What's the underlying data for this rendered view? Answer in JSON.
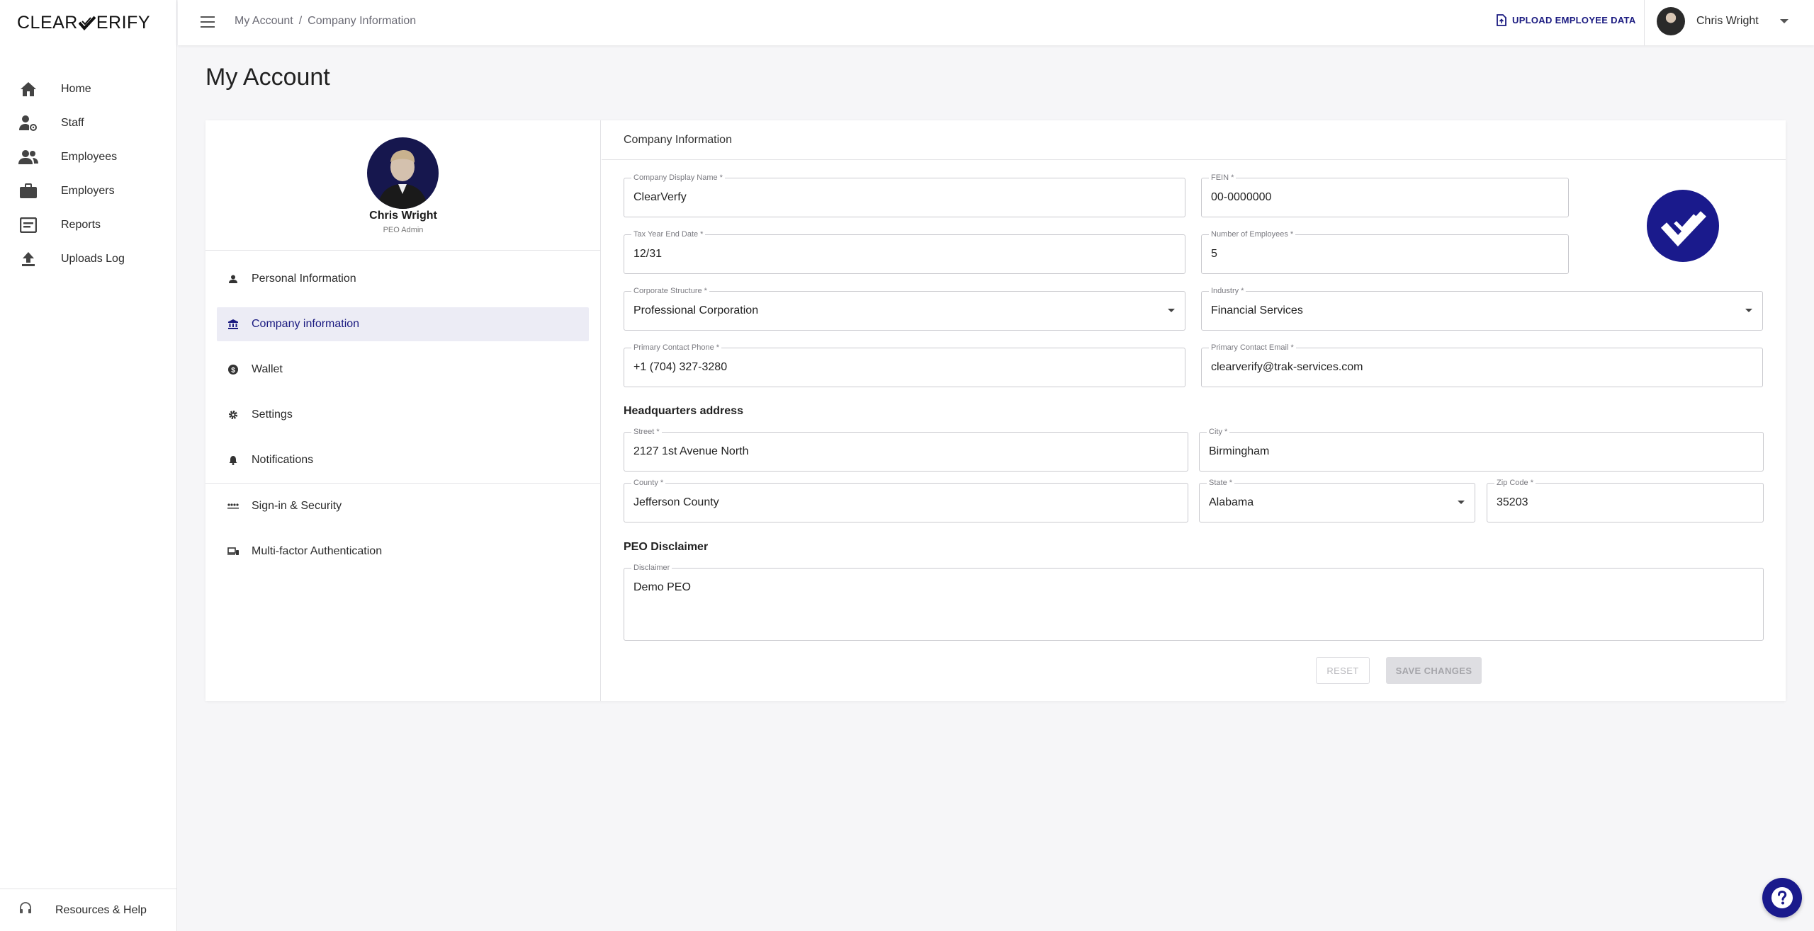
{
  "app": {
    "logo_left": "CLEAR",
    "logo_right": "ERIFY",
    "brand_color": "#1a1a8c"
  },
  "sidebar": {
    "items": [
      {
        "label": "Home",
        "icon": "home-icon"
      },
      {
        "label": "Staff",
        "icon": "staff-icon"
      },
      {
        "label": "Employees",
        "icon": "employees-icon"
      },
      {
        "label": "Employers",
        "icon": "briefcase-icon"
      },
      {
        "label": "Reports",
        "icon": "reports-icon"
      },
      {
        "label": "Uploads Log",
        "icon": "upload-icon"
      }
    ],
    "footer": {
      "label": "Resources & Help",
      "icon": "headset-icon"
    }
  },
  "topbar": {
    "breadcrumb": [
      "My Account",
      "Company Information"
    ],
    "separator": "/",
    "upload_label": "UPLOAD EMPLOYEE DATA",
    "user_name": "Chris Wright"
  },
  "page": {
    "title": "My Account"
  },
  "profile": {
    "name": "Chris Wright",
    "role": "PEO Admin"
  },
  "account_menu": {
    "items": [
      {
        "label": "Personal Information",
        "icon": "person-icon"
      },
      {
        "label": "Company information",
        "icon": "bank-icon",
        "active": true
      },
      {
        "label": "Wallet",
        "icon": "dollar-icon"
      },
      {
        "label": "Settings",
        "icon": "gear-icon"
      },
      {
        "label": "Notifications",
        "icon": "bell-icon"
      },
      {
        "label": "Sign-in & Security",
        "icon": "password-icon"
      },
      {
        "label": "Multi-factor Authentication",
        "icon": "devices-icon"
      }
    ]
  },
  "company_form": {
    "header": "Company Information",
    "display_name": {
      "label": "Company Display Name *",
      "value": "ClearVerfy"
    },
    "fein": {
      "label": "FEIN *",
      "value": "00-0000000"
    },
    "tax_year_end": {
      "label": "Tax Year End Date *",
      "value": "12/31"
    },
    "num_employees": {
      "label": "Number of Employees *",
      "value": "5"
    },
    "corporate_structure": {
      "label": "Corporate Structure *",
      "value": "Professional Corporation"
    },
    "industry": {
      "label": "Industry *",
      "value": "Financial Services"
    },
    "phone": {
      "label": "Primary Contact Phone *",
      "value": "+1 (704) 327-3280"
    },
    "email": {
      "label": "Primary Contact Email *",
      "value": "clearverify@trak-services.com"
    },
    "hq_title": "Headquarters address",
    "street": {
      "label": "Street *",
      "value": "2127 1st Avenue North"
    },
    "city": {
      "label": "City *",
      "value": "Birmingham"
    },
    "county": {
      "label": "County *",
      "value": "Jefferson County"
    },
    "state": {
      "label": "State *",
      "value": "Alabama"
    },
    "zip": {
      "label": "Zip Code *",
      "value": "35203"
    },
    "disclaimer_title": "PEO Disclaimer",
    "disclaimer": {
      "label": "Disclaimer",
      "value": "Demo PEO"
    },
    "reset_label": "RESET",
    "save_label": "SAVE CHANGES"
  }
}
